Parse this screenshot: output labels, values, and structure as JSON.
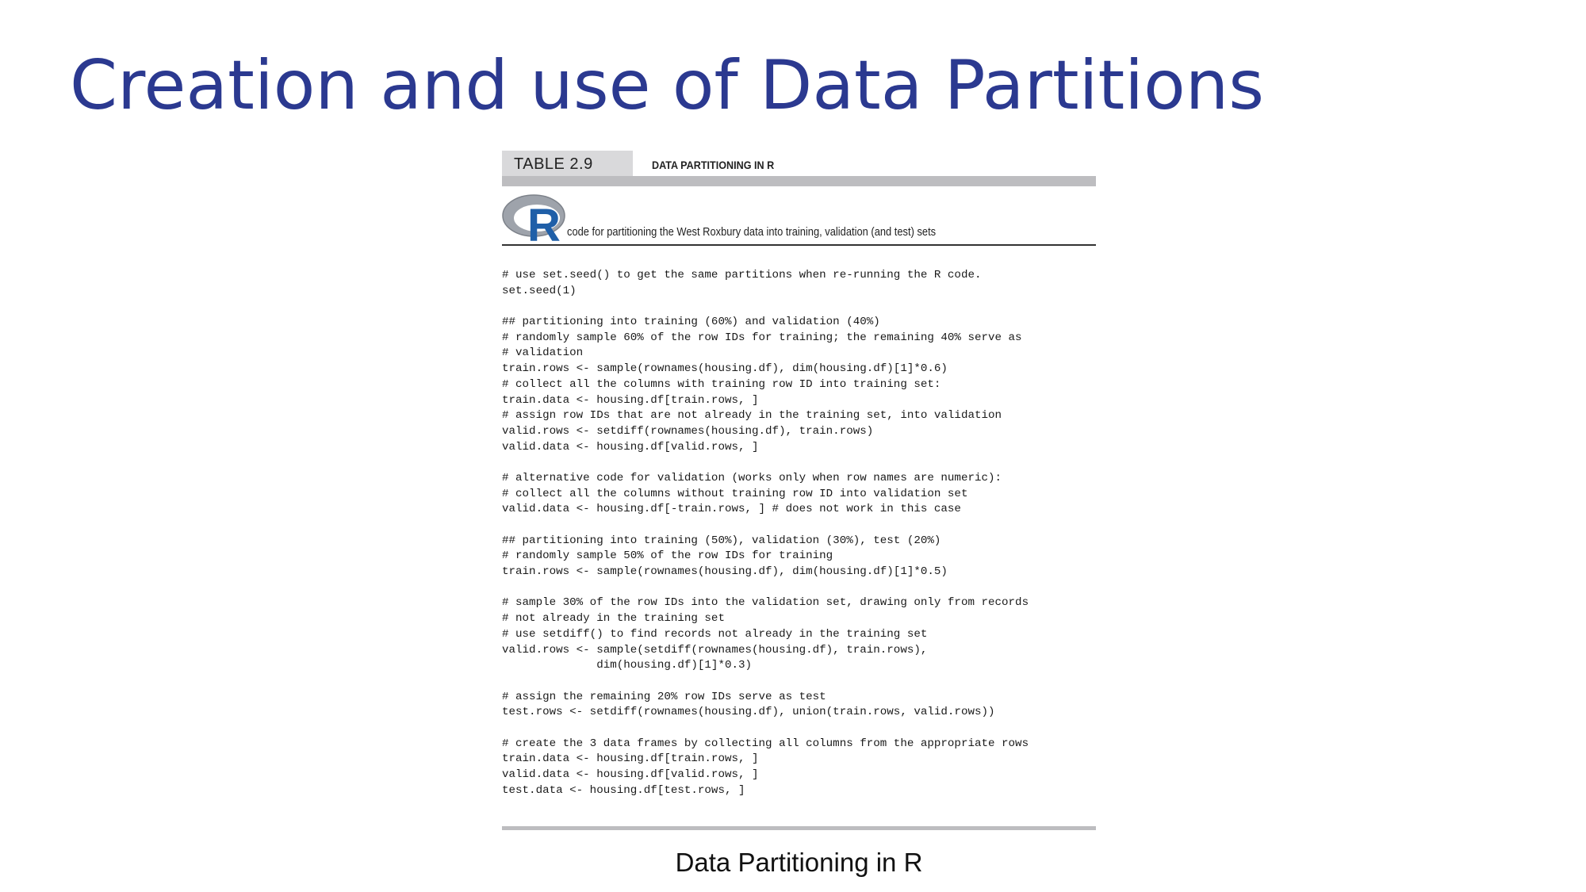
{
  "title": "Creation and use of Data Partitions",
  "table": {
    "label": "TABLE 2.9",
    "heading": "DATA PARTITIONING IN R",
    "logo_text": "R",
    "caption": "code for partitioning the West Roxbury data into training, validation (and test) sets"
  },
  "code_lines": [
    "# use set.seed() to get the same partitions when re-running the R code.",
    "set.seed(1)",
    "",
    "## partitioning into training (60%) and validation (40%)",
    "# randomly sample 60% of the row IDs for training; the remaining 40% serve as",
    "# validation",
    "train.rows <- sample(rownames(housing.df), dim(housing.df)[1]*0.6)",
    "# collect all the columns with training row ID into training set:",
    "train.data <- housing.df[train.rows, ]",
    "# assign row IDs that are not already in the training set, into validation",
    "valid.rows <- setdiff(rownames(housing.df), train.rows)",
    "valid.data <- housing.df[valid.rows, ]",
    "",
    "# alternative code for validation (works only when row names are numeric):",
    "# collect all the columns without training row ID into validation set",
    "valid.data <- housing.df[-train.rows, ] # does not work in this case",
    "",
    "## partitioning into training (50%), validation (30%), test (20%)",
    "# randomly sample 50% of the row IDs for training",
    "train.rows <- sample(rownames(housing.df), dim(housing.df)[1]*0.5)",
    "",
    "# sample 30% of the row IDs into the validation set, drawing only from records",
    "# not already in the training set",
    "# use setdiff() to find records not already in the training set",
    "valid.rows <- sample(setdiff(rownames(housing.df), train.rows),",
    "              dim(housing.df)[1]*0.3)",
    "",
    "# assign the remaining 20% row IDs serve as test",
    "test.rows <- setdiff(rownames(housing.df), union(train.rows, valid.rows))",
    "",
    "# create the 3 data frames by collecting all columns from the appropriate rows",
    "train.data <- housing.df[train.rows, ]",
    "valid.data <- housing.df[valid.rows, ]",
    "test.data <- housing.df[test.rows, ]"
  ],
  "figure_caption": "Data Partitioning in R",
  "colors": {
    "title": "#2b3990",
    "r_logo_blue": "#1f5fa8",
    "r_logo_ring": "#9ea3ab",
    "bar_gray": "#bdbdc0"
  }
}
